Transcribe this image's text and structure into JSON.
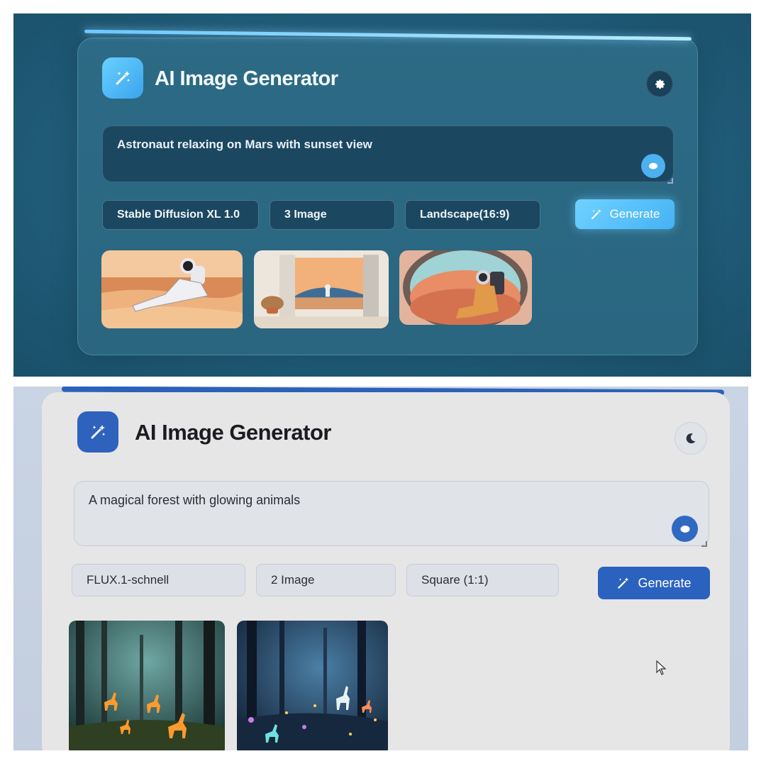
{
  "photos": [
    {
      "theme": "dark",
      "header": {
        "title": "AI Image Generator",
        "logo_icon": "magic-wand-icon",
        "action_icon": "gear-icon"
      },
      "prompt": {
        "text": "Astronaut relaxing on Mars with sunset view",
        "mic_icon": "microphone-icon"
      },
      "controls": {
        "model": "Stable Diffusion XL 1.0",
        "count": "3 Image",
        "ratio": "Landscape(16:9)",
        "generate_label": "Generate",
        "generate_icon": "magic-wand-icon"
      },
      "results": {
        "count": 3
      },
      "colors": {
        "accent": "#4db0ef",
        "background": "#22617e",
        "card": "#2a6680"
      }
    },
    {
      "theme": "light",
      "header": {
        "title": "AI Image Generator",
        "logo_icon": "magic-wand-icon",
        "action_icon": "moon-icon"
      },
      "prompt": {
        "text": "A magical forest with glowing animals",
        "mic_icon": "microphone-icon"
      },
      "controls": {
        "model": "FLUX.1-schnell",
        "count": "2 Image",
        "ratio": "Square (1:1)",
        "generate_label": "Generate",
        "generate_icon": "magic-wand-icon"
      },
      "results": {
        "count": 2
      },
      "colors": {
        "accent": "#2c62bf",
        "background": "#c9d4e4",
        "card": "#e7e6e6"
      }
    }
  ]
}
